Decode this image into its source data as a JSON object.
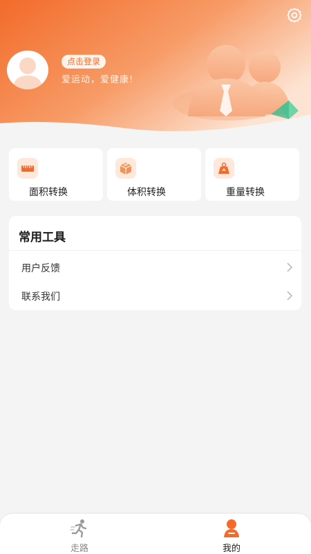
{
  "header": {
    "login_label": "点击登录",
    "slogan": "爱运动，爱健康!"
  },
  "converters": [
    {
      "label": "面积转换",
      "icon": "ruler-icon"
    },
    {
      "label": "体积转换",
      "icon": "box-icon"
    },
    {
      "label": "重量转换",
      "icon": "weight-icon"
    }
  ],
  "tools": {
    "title": "常用工具",
    "items": [
      {
        "label": "用户反馈"
      },
      {
        "label": "联系我们"
      }
    ]
  },
  "tabbar": {
    "tabs": [
      {
        "label": "走路",
        "icon": "running-icon",
        "active": false
      },
      {
        "label": "我的",
        "icon": "user-icon",
        "active": true
      }
    ]
  },
  "colors": {
    "accent": "#f26b2a",
    "header_gradient_start": "#f47a3a",
    "header_gradient_end": "#ffe1cc",
    "inactive_tab": "#888888"
  }
}
